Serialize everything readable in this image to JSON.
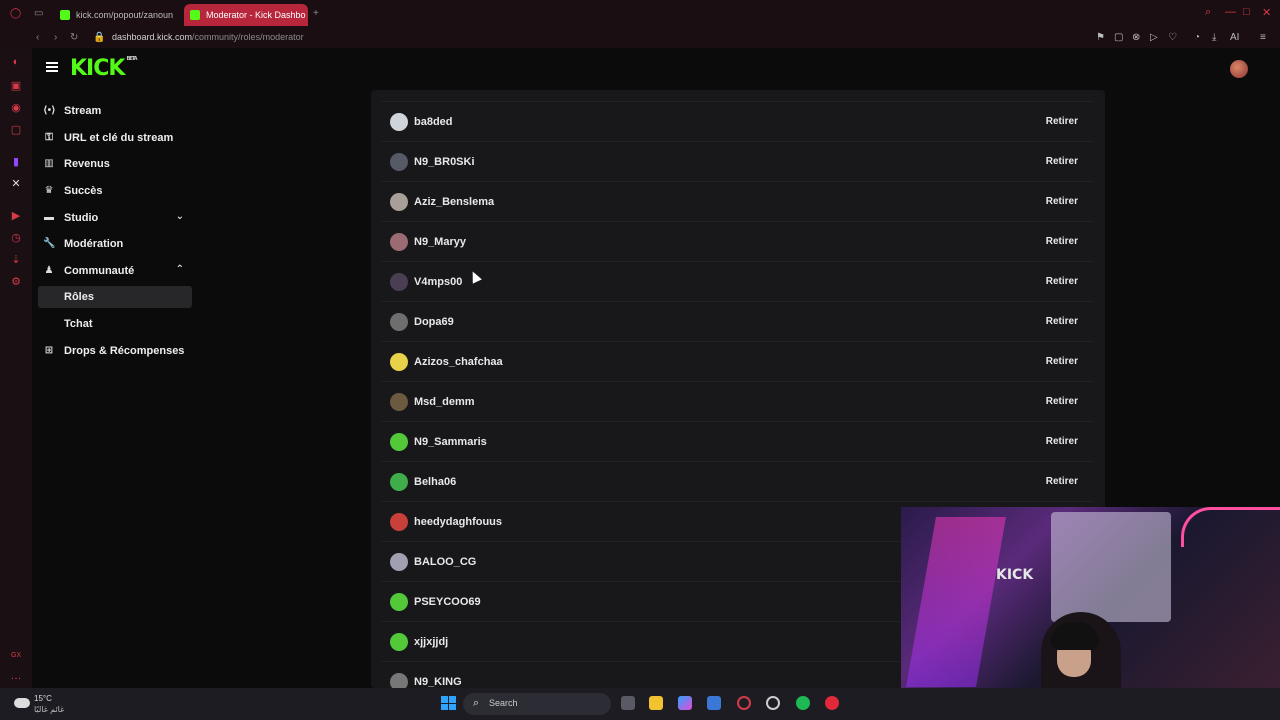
{
  "browser": {
    "tabs": [
      {
        "title": "kick.com/popout/zanoun",
        "active": false
      },
      {
        "title": "Moderator - Kick Dashbo",
        "active": true
      }
    ],
    "url_domain": "dashboard.kick.com",
    "url_path": "/community/roles/moderator"
  },
  "header": {
    "logo": "KICK",
    "logo_badge": "BETA"
  },
  "sidebar": {
    "items": [
      {
        "label": "Stream",
        "icon": "broadcast-icon"
      },
      {
        "label": "URL et clé du stream",
        "icon": "key-icon"
      },
      {
        "label": "Revenus",
        "icon": "chart-icon"
      },
      {
        "label": "Succès",
        "icon": "trophy-icon"
      },
      {
        "label": "Studio",
        "icon": "studio-icon"
      },
      {
        "label": "Modération",
        "icon": "wrench-icon"
      },
      {
        "label": "Communauté",
        "icon": "community-icon"
      },
      {
        "label": "Rôles"
      },
      {
        "label": "Tchat"
      },
      {
        "label": "Drops & Récompenses",
        "icon": "gift-icon"
      }
    ]
  },
  "moderators": {
    "remove_label": "Retirer",
    "rows": [
      {
        "name": "ba8ded",
        "color": "#cfd3da"
      },
      {
        "name": "N9_BR0SKi",
        "color": "#555a66"
      },
      {
        "name": "Aziz_Benslema",
        "color": "#a89f98"
      },
      {
        "name": "N9_Maryy",
        "color": "#9a6b72"
      },
      {
        "name": "V4mps00",
        "color": "#4a3e52"
      },
      {
        "name": "Dopa69",
        "color": "#6e6e6e"
      },
      {
        "name": "Azizos_chafchaa",
        "color": "#e8d24a"
      },
      {
        "name": "Msd_demm",
        "color": "#6b5a40"
      },
      {
        "name": "N9_Sammaris",
        "color": "#53c93a"
      },
      {
        "name": "Belha06",
        "color": "#3fae4a"
      },
      {
        "name": "heedydaghfouus",
        "color": "#c9403a"
      },
      {
        "name": "BALOO_CG",
        "color": "#a0a0b0"
      },
      {
        "name": "PSEYCOO69",
        "color": "#53c93a"
      },
      {
        "name": "xjjxjjdj",
        "color": "#53c93a"
      },
      {
        "name": "N9_KING",
        "color": "#777"
      }
    ]
  },
  "webcam": {
    "sign_text": "KICK"
  },
  "taskbar": {
    "temperature": "15°C",
    "weather_text": "غائم غالبًا",
    "search_placeholder": "Search"
  }
}
